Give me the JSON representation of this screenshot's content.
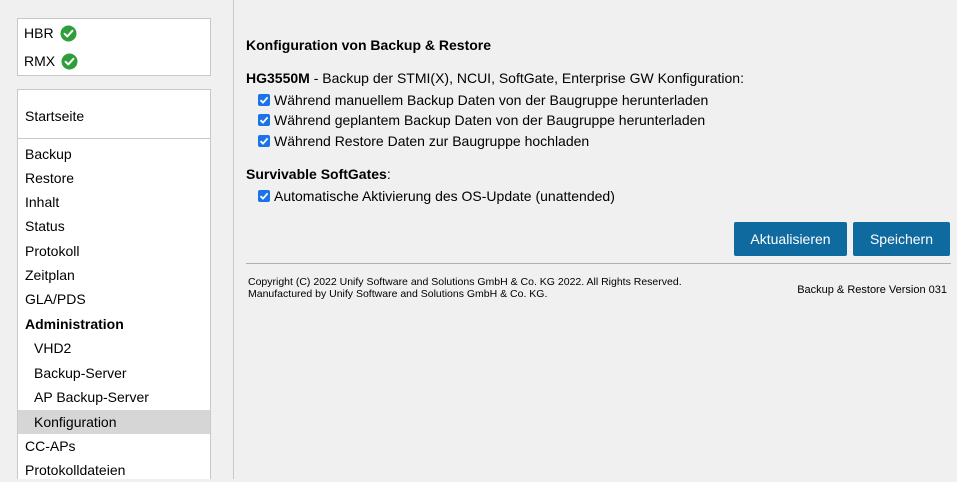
{
  "status": [
    {
      "name": "HBR",
      "icon": "check-circle-icon",
      "color": "#2e9e3a"
    },
    {
      "name": "RMX",
      "icon": "check-circle-icon",
      "color": "#2e9e3a"
    }
  ],
  "nav": {
    "home": "Startseite",
    "items": [
      {
        "label": "Backup"
      },
      {
        "label": "Restore"
      },
      {
        "label": "Inhalt"
      },
      {
        "label": "Status"
      },
      {
        "label": "Protokoll"
      },
      {
        "label": "Zeitplan"
      },
      {
        "label": "GLA/PDS"
      },
      {
        "label": "Administration"
      },
      {
        "label": "VHD2"
      },
      {
        "label": "Backup-Server"
      },
      {
        "label": "AP Backup-Server"
      },
      {
        "label": "Konfiguration"
      },
      {
        "label": "CC-APs"
      },
      {
        "label": "Protokolldateien"
      }
    ],
    "active": "Konfiguration"
  },
  "main": {
    "title": "Konfiguration von Backup & Restore",
    "hg_model": "HG3550M",
    "hg_desc": " - Backup der STMI(X), NCUI, SoftGate, Enterprise GW Konfiguration:",
    "hg_options": [
      {
        "label": "Während manuellem Backup Daten von der Baugruppe herunterladen",
        "checked": true
      },
      {
        "label": "Während geplantem Backup Daten von der Baugruppe herunterladen",
        "checked": true
      },
      {
        "label": "Während Restore Daten zur Baugruppe hochladen",
        "checked": true
      }
    ],
    "sg_title": "Survivable SoftGates",
    "sg_colon": ":",
    "sg_options": [
      {
        "label": "Automatische Aktivierung des OS-Update (unattended)",
        "checked": true
      }
    ],
    "buttons": {
      "refresh": "Aktualisieren",
      "save": "Speichern"
    },
    "accent": "#0f6aa0"
  },
  "footer": {
    "copyright_line1": "Copyright (C) 2022 Unify Software and Solutions GmbH & Co. KG 2022. All Rights Reserved.",
    "copyright_line2": "Manufactured by Unify Software and Solutions GmbH & Co. KG.",
    "version": "Backup & Restore Version 031"
  }
}
